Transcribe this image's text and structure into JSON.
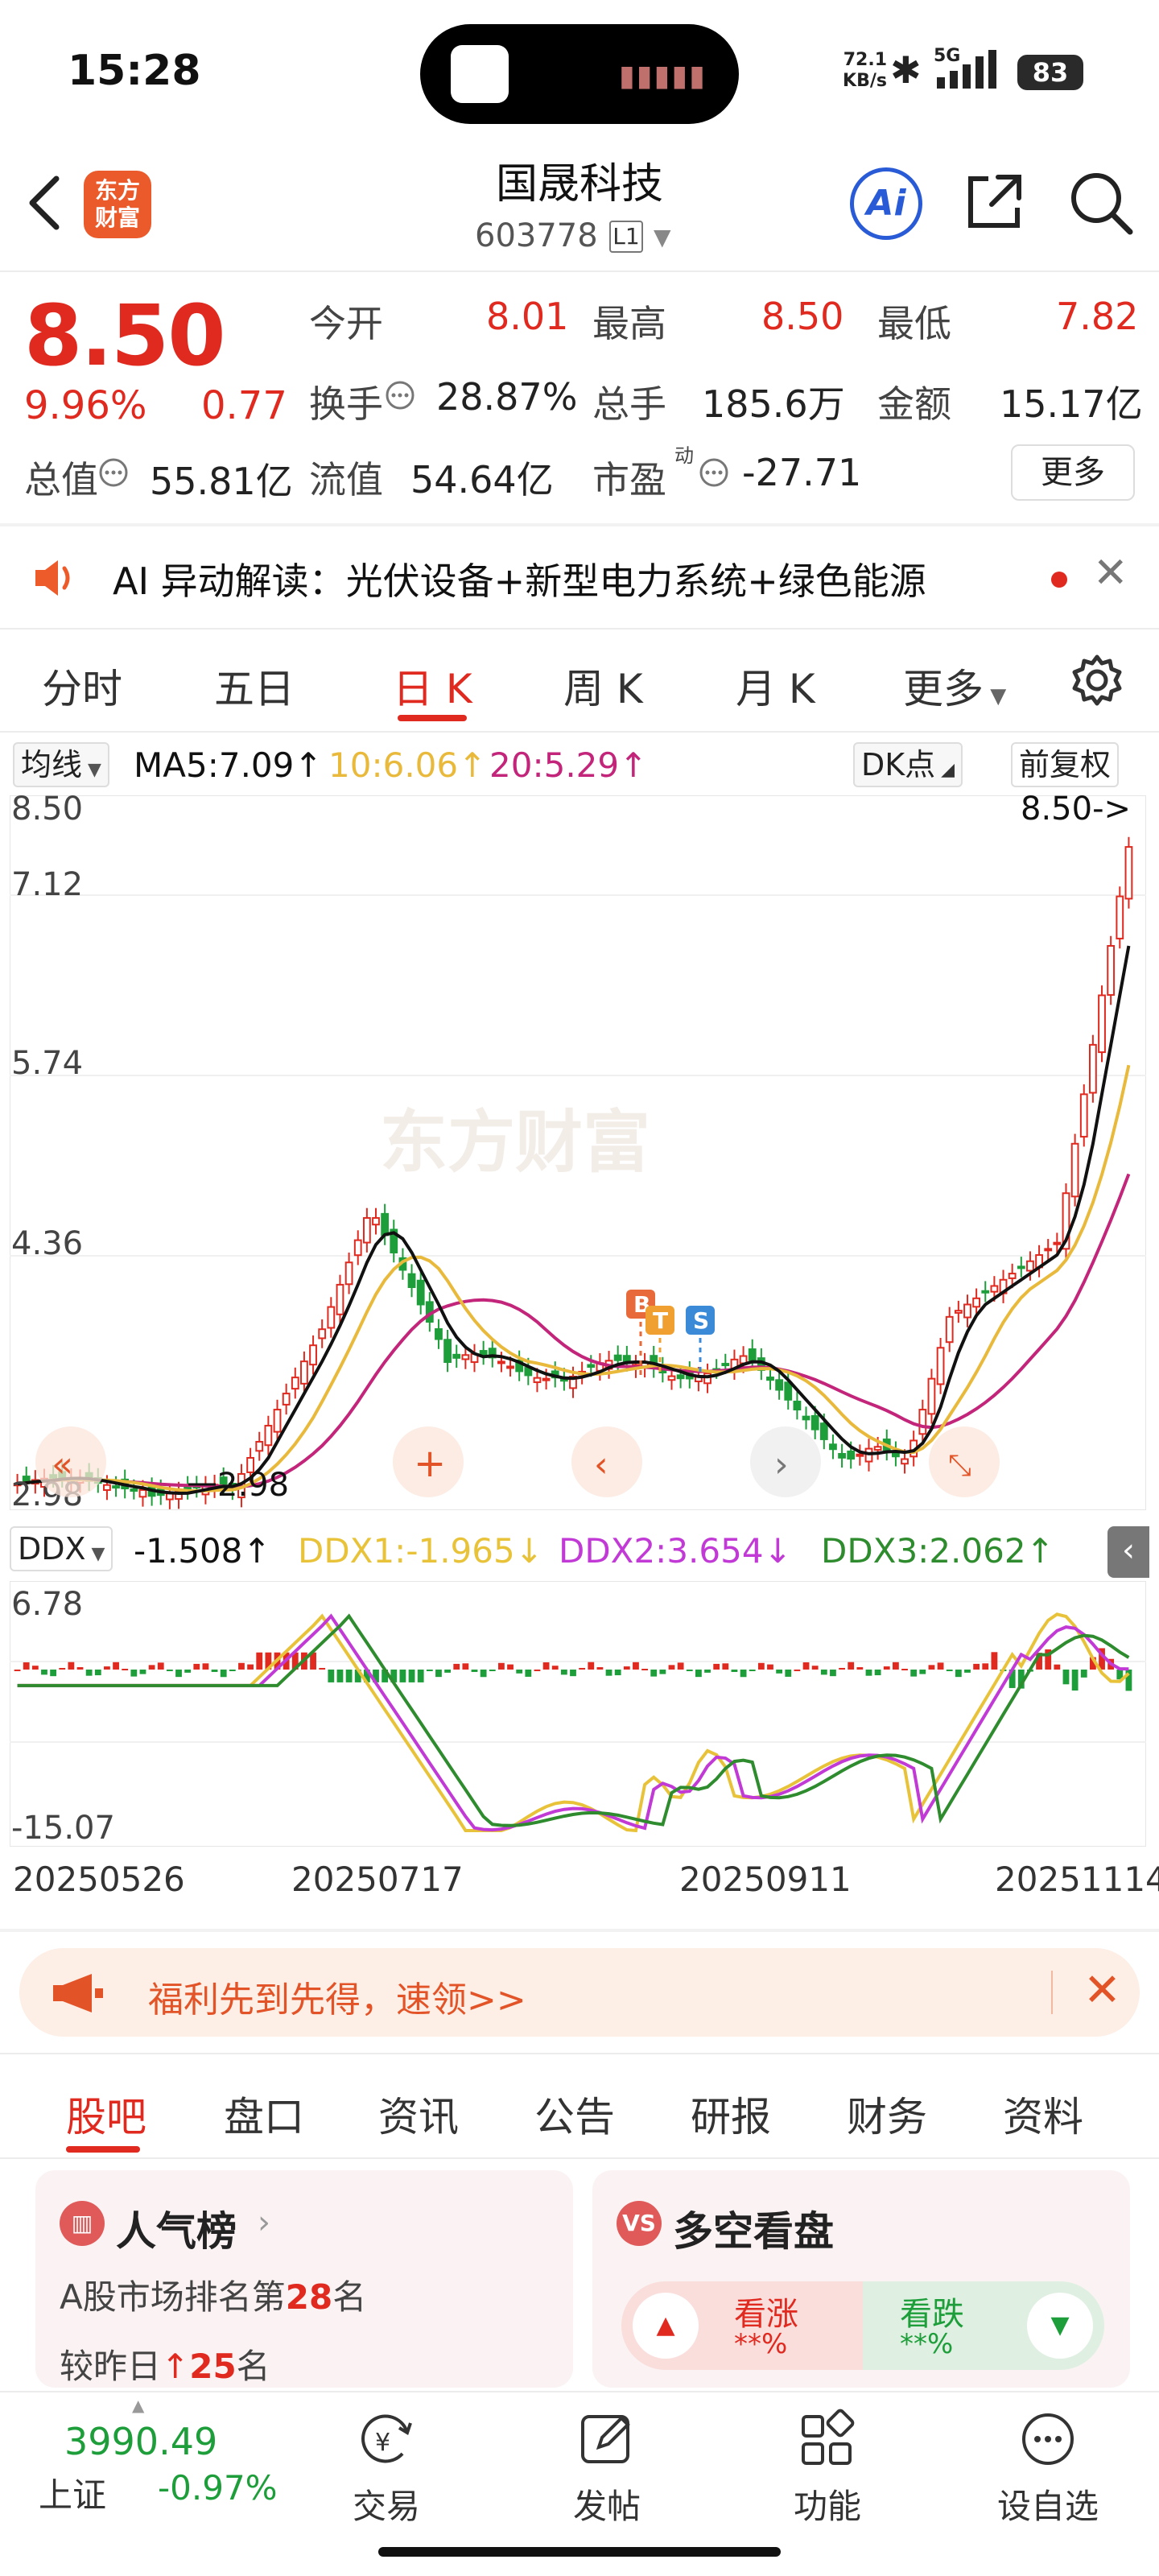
{
  "status_bar": {
    "time": "15:28",
    "net_speed_value": "72.1",
    "net_speed_unit": "KB/s",
    "network": "5G",
    "battery": "83"
  },
  "header": {
    "logo_line1": "东方",
    "logo_line2": "财富",
    "stock_name": "国晟科技",
    "stock_code": "603778",
    "level_badge": "L1",
    "ai_label": "Ai"
  },
  "quote": {
    "price": "8.50",
    "change_pct": "9.96%",
    "change": "0.77",
    "open_label": "今开",
    "open": "8.01",
    "high_label": "最高",
    "high": "8.50",
    "low_label": "最低",
    "low": "7.82",
    "turnover_label": "换手",
    "turnover": "28.87%",
    "volume_label": "总手",
    "volume": "185.6万",
    "amount_label": "金额",
    "amount": "15.17亿",
    "mcap_label": "总值",
    "mcap": "55.81亿",
    "float_label": "流值",
    "float_cap": "54.64亿",
    "pe_label": "市盈",
    "pe_sup": "动",
    "pe": "-27.71",
    "more_label": "更多"
  },
  "ai_banner": {
    "text": "AI 异动解读：光伏设备+新型电力系统+绿色能源"
  },
  "chart_tabs": [
    "分时",
    "五日",
    "日 K",
    "周 K",
    "月 K",
    "更多"
  ],
  "ma_row": {
    "selector": "均线",
    "ma5": "MA5:7.09",
    "ma10": "10:6.06",
    "ma20": "20:5.29",
    "dk_label": "DK点",
    "adjust_label": "前复权"
  },
  "kline": {
    "y_ticks": [
      "8.50",
      "7.12",
      "5.74",
      "4.36",
      "2.98"
    ],
    "last_price_marker": "8.50->",
    "min_label": "2.98",
    "watermark": "东方财富",
    "signal_b": "B",
    "signal_t": "T",
    "signal_s": "S"
  },
  "ddx_row": {
    "selector": "DDX",
    "ddx": "-1.508",
    "ddx1": "DDX1:-1.965",
    "ddx2": "DDX2:3.654",
    "ddx3": "DDX3:2.062"
  },
  "ddx_chart": {
    "y_max": "6.78",
    "y_min": "-15.07"
  },
  "date_axis": [
    "20250526",
    "20250717",
    "20250911",
    "20251114"
  ],
  "promo": {
    "text": "福利先到先得，速领>>"
  },
  "info_tabs": [
    "股吧",
    "盘口",
    "资讯",
    "公告",
    "研报",
    "财务",
    "资料"
  ],
  "rank_card": {
    "title": "人气榜",
    "line1_prefix": "A股市场排名第",
    "rank": "28",
    "line1_suffix": "名",
    "line2_prefix": "较昨日",
    "rank_change": "25",
    "line2_suffix": "名"
  },
  "ls_card": {
    "title": "多空看盘",
    "bull_label": "看涨",
    "bull_value": "**%",
    "bear_label": "看跌",
    "bear_value": "**%"
  },
  "bottom_nav": {
    "index_value": "3990.49",
    "index_name": "上证",
    "index_change": "-0.97%",
    "trade": "交易",
    "post": "发帖",
    "functions": "功能",
    "watchlist": "设自选"
  },
  "colors": {
    "up": "#e0291f",
    "down": "#1e9e3a",
    "ma5": "#111111",
    "ma10": "#e8b93a",
    "ma20": "#c2257a",
    "ddx1": "#e8c33a",
    "ddx2": "#c23ad6",
    "ddx3": "#2e8b2e"
  }
}
